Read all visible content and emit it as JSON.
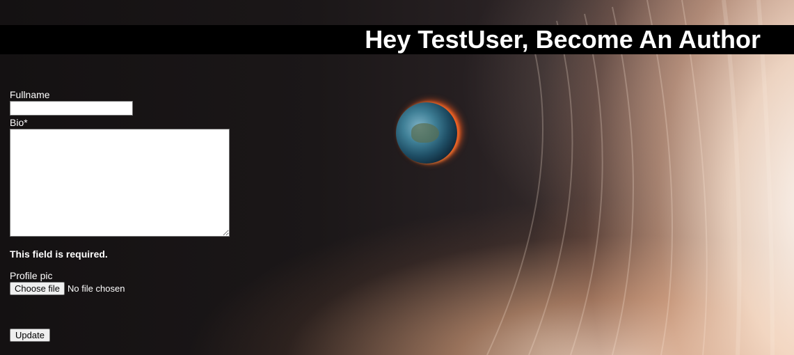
{
  "header": {
    "title": "Hey TestUser, Become An Author"
  },
  "form": {
    "fullname_label": "Fullname",
    "fullname_value": "",
    "bio_label": "Bio*",
    "bio_value": "",
    "bio_error": "This field is required.",
    "profile_pic_label": "Profile pic",
    "file_button_label": "Choose file",
    "file_status": "No file chosen",
    "submit_label": "Update"
  }
}
